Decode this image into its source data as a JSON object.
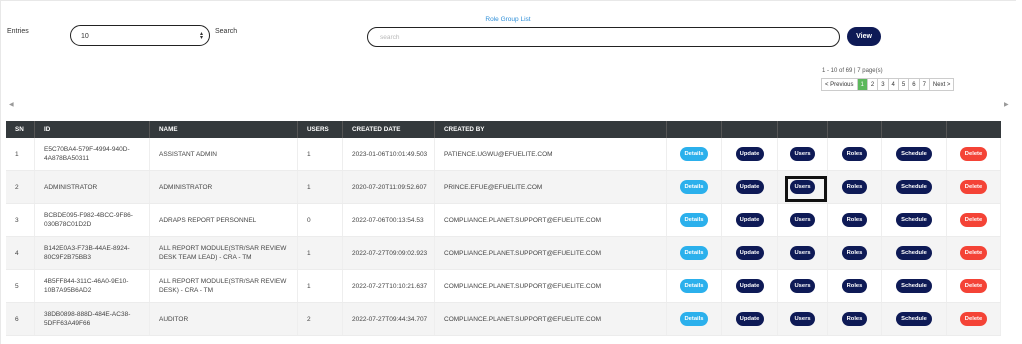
{
  "page": {
    "title": "Role Group List"
  },
  "controls": {
    "entries_label": "Entries",
    "entries_value": "10",
    "search_label": "Search",
    "search_placeholder": "search",
    "view_label": "View"
  },
  "pagination": {
    "info": "1 - 10 of 69 | 7 page(s)",
    "prev": "< Previous",
    "pages": [
      "1",
      "2",
      "3",
      "4",
      "5",
      "6",
      "7"
    ],
    "current": "1",
    "next": "Next >"
  },
  "table": {
    "columns": [
      "SN",
      "ID",
      "NAME",
      "USERS",
      "CREATED DATE",
      "CREATED BY",
      "",
      "",
      "",
      "",
      "",
      ""
    ],
    "action_labels": {
      "details": "Details",
      "update": "Update",
      "users": "Users",
      "roles": "Roles",
      "schedule": "Schedule",
      "delete": "Delete"
    },
    "rows": [
      {
        "sn": "1",
        "id": "E5C70BA4-579F-4994-940D-4A878BA50311",
        "name": "ASSISTANT ADMIN",
        "users": "1",
        "created_date": "2023-01-06T10:01:49.503",
        "created_by": "PATIENCE.UGWU@EFUELITE.COM"
      },
      {
        "sn": "2",
        "id": "ADMINISTRATOR",
        "name": "ADMINISTRATOR",
        "users": "1",
        "created_date": "2020-07-20T11:09:52.607",
        "created_by": "PRINCE.EFUE@EFUELITE.COM"
      },
      {
        "sn": "3",
        "id": "BCBDE095-F982-4BCC-9F86-030B78C01D2D",
        "name": "ADRAPS REPORT PERSONNEL",
        "users": "0",
        "created_date": "2022-07-06T00:13:54.53",
        "created_by": "COMPLIANCE.PLANET.SUPPORT@EFUELITE.COM"
      },
      {
        "sn": "4",
        "id": "B142E0A3-F73B-44AE-8924-80C9F2B75BB3",
        "name": "ALL REPORT MODULE(STR/SAR REVIEW DESK TEAM LEAD) - CRA - TM",
        "users": "1",
        "created_date": "2022-07-27T09:09:02.923",
        "created_by": "COMPLIANCE.PLANET.SUPPORT@EFUELITE.COM"
      },
      {
        "sn": "5",
        "id": "4B5FF844-311C-46A0-9E10-10B7A95B6AD2",
        "name": "ALL REPORT MODULE(STR/SAR REVIEW DESK) - CRA - TM",
        "users": "1",
        "created_date": "2022-07-27T10:10:21.637",
        "created_by": "COMPLIANCE.PLANET.SUPPORT@EFUELITE.COM"
      },
      {
        "sn": "6",
        "id": "38DB0898-888D-484E-AC38-5DFF63A49F66",
        "name": "AUDITOR",
        "users": "2",
        "created_date": "2022-07-27T09:44:34.707",
        "created_by": "COMPLIANCE.PLANET.SUPPORT@EFUELITE.COM"
      }
    ]
  },
  "colors": {
    "primary_dark": "#0e1a56",
    "details_blue": "#2bb0ec",
    "delete_red": "#f44336",
    "header_dark": "#34393c",
    "active_page_green": "#5cb85c",
    "title_blue": "#2f8fd8"
  }
}
